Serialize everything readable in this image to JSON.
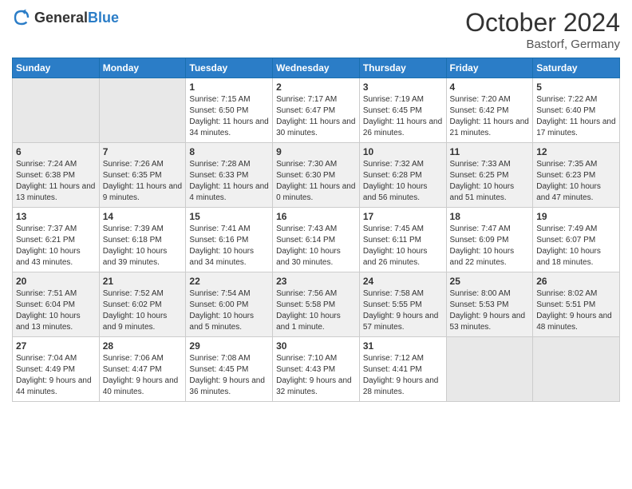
{
  "header": {
    "logo_general": "General",
    "logo_blue": "Blue",
    "month_year": "October 2024",
    "location": "Bastorf, Germany"
  },
  "days_of_week": [
    "Sunday",
    "Monday",
    "Tuesday",
    "Wednesday",
    "Thursday",
    "Friday",
    "Saturday"
  ],
  "weeks": [
    [
      {
        "day": "",
        "empty": true
      },
      {
        "day": "",
        "empty": true
      },
      {
        "day": "1",
        "sunrise": "Sunrise: 7:15 AM",
        "sunset": "Sunset: 6:50 PM",
        "daylight": "Daylight: 11 hours and 34 minutes."
      },
      {
        "day": "2",
        "sunrise": "Sunrise: 7:17 AM",
        "sunset": "Sunset: 6:47 PM",
        "daylight": "Daylight: 11 hours and 30 minutes."
      },
      {
        "day": "3",
        "sunrise": "Sunrise: 7:19 AM",
        "sunset": "Sunset: 6:45 PM",
        "daylight": "Daylight: 11 hours and 26 minutes."
      },
      {
        "day": "4",
        "sunrise": "Sunrise: 7:20 AM",
        "sunset": "Sunset: 6:42 PM",
        "daylight": "Daylight: 11 hours and 21 minutes."
      },
      {
        "day": "5",
        "sunrise": "Sunrise: 7:22 AM",
        "sunset": "Sunset: 6:40 PM",
        "daylight": "Daylight: 11 hours and 17 minutes."
      }
    ],
    [
      {
        "day": "6",
        "sunrise": "Sunrise: 7:24 AM",
        "sunset": "Sunset: 6:38 PM",
        "daylight": "Daylight: 11 hours and 13 minutes."
      },
      {
        "day": "7",
        "sunrise": "Sunrise: 7:26 AM",
        "sunset": "Sunset: 6:35 PM",
        "daylight": "Daylight: 11 hours and 9 minutes."
      },
      {
        "day": "8",
        "sunrise": "Sunrise: 7:28 AM",
        "sunset": "Sunset: 6:33 PM",
        "daylight": "Daylight: 11 hours and 4 minutes."
      },
      {
        "day": "9",
        "sunrise": "Sunrise: 7:30 AM",
        "sunset": "Sunset: 6:30 PM",
        "daylight": "Daylight: 11 hours and 0 minutes."
      },
      {
        "day": "10",
        "sunrise": "Sunrise: 7:32 AM",
        "sunset": "Sunset: 6:28 PM",
        "daylight": "Daylight: 10 hours and 56 minutes."
      },
      {
        "day": "11",
        "sunrise": "Sunrise: 7:33 AM",
        "sunset": "Sunset: 6:25 PM",
        "daylight": "Daylight: 10 hours and 51 minutes."
      },
      {
        "day": "12",
        "sunrise": "Sunrise: 7:35 AM",
        "sunset": "Sunset: 6:23 PM",
        "daylight": "Daylight: 10 hours and 47 minutes."
      }
    ],
    [
      {
        "day": "13",
        "sunrise": "Sunrise: 7:37 AM",
        "sunset": "Sunset: 6:21 PM",
        "daylight": "Daylight: 10 hours and 43 minutes."
      },
      {
        "day": "14",
        "sunrise": "Sunrise: 7:39 AM",
        "sunset": "Sunset: 6:18 PM",
        "daylight": "Daylight: 10 hours and 39 minutes."
      },
      {
        "day": "15",
        "sunrise": "Sunrise: 7:41 AM",
        "sunset": "Sunset: 6:16 PM",
        "daylight": "Daylight: 10 hours and 34 minutes."
      },
      {
        "day": "16",
        "sunrise": "Sunrise: 7:43 AM",
        "sunset": "Sunset: 6:14 PM",
        "daylight": "Daylight: 10 hours and 30 minutes."
      },
      {
        "day": "17",
        "sunrise": "Sunrise: 7:45 AM",
        "sunset": "Sunset: 6:11 PM",
        "daylight": "Daylight: 10 hours and 26 minutes."
      },
      {
        "day": "18",
        "sunrise": "Sunrise: 7:47 AM",
        "sunset": "Sunset: 6:09 PM",
        "daylight": "Daylight: 10 hours and 22 minutes."
      },
      {
        "day": "19",
        "sunrise": "Sunrise: 7:49 AM",
        "sunset": "Sunset: 6:07 PM",
        "daylight": "Daylight: 10 hours and 18 minutes."
      }
    ],
    [
      {
        "day": "20",
        "sunrise": "Sunrise: 7:51 AM",
        "sunset": "Sunset: 6:04 PM",
        "daylight": "Daylight: 10 hours and 13 minutes."
      },
      {
        "day": "21",
        "sunrise": "Sunrise: 7:52 AM",
        "sunset": "Sunset: 6:02 PM",
        "daylight": "Daylight: 10 hours and 9 minutes."
      },
      {
        "day": "22",
        "sunrise": "Sunrise: 7:54 AM",
        "sunset": "Sunset: 6:00 PM",
        "daylight": "Daylight: 10 hours and 5 minutes."
      },
      {
        "day": "23",
        "sunrise": "Sunrise: 7:56 AM",
        "sunset": "Sunset: 5:58 PM",
        "daylight": "Daylight: 10 hours and 1 minute."
      },
      {
        "day": "24",
        "sunrise": "Sunrise: 7:58 AM",
        "sunset": "Sunset: 5:55 PM",
        "daylight": "Daylight: 9 hours and 57 minutes."
      },
      {
        "day": "25",
        "sunrise": "Sunrise: 8:00 AM",
        "sunset": "Sunset: 5:53 PM",
        "daylight": "Daylight: 9 hours and 53 minutes."
      },
      {
        "day": "26",
        "sunrise": "Sunrise: 8:02 AM",
        "sunset": "Sunset: 5:51 PM",
        "daylight": "Daylight: 9 hours and 48 minutes."
      }
    ],
    [
      {
        "day": "27",
        "sunrise": "Sunrise: 7:04 AM",
        "sunset": "Sunset: 4:49 PM",
        "daylight": "Daylight: 9 hours and 44 minutes."
      },
      {
        "day": "28",
        "sunrise": "Sunrise: 7:06 AM",
        "sunset": "Sunset: 4:47 PM",
        "daylight": "Daylight: 9 hours and 40 minutes."
      },
      {
        "day": "29",
        "sunrise": "Sunrise: 7:08 AM",
        "sunset": "Sunset: 4:45 PM",
        "daylight": "Daylight: 9 hours and 36 minutes."
      },
      {
        "day": "30",
        "sunrise": "Sunrise: 7:10 AM",
        "sunset": "Sunset: 4:43 PM",
        "daylight": "Daylight: 9 hours and 32 minutes."
      },
      {
        "day": "31",
        "sunrise": "Sunrise: 7:12 AM",
        "sunset": "Sunset: 4:41 PM",
        "daylight": "Daylight: 9 hours and 28 minutes."
      },
      {
        "day": "",
        "empty": true
      },
      {
        "day": "",
        "empty": true
      }
    ]
  ]
}
